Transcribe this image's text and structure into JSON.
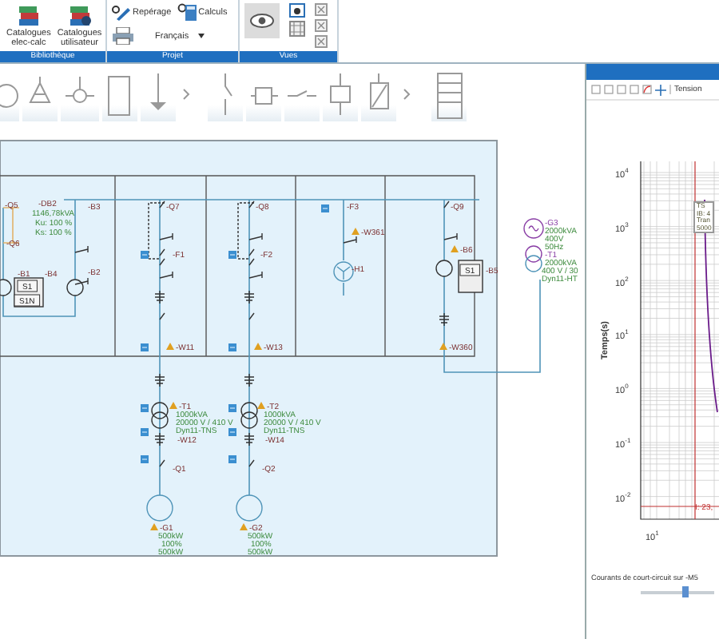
{
  "ribbon": {
    "groups": [
      {
        "label": "Bibliothèque",
        "items": [
          {
            "kind": "big",
            "label": "Catalogues elec-calc"
          },
          {
            "kind": "big",
            "label": "Catalogues utilisateur"
          }
        ]
      },
      {
        "label": "Projet",
        "items": [
          {
            "kind": "tool",
            "label": "Repérage"
          },
          {
            "kind": "tool",
            "label": "Calculs"
          },
          {
            "kind": "dropdown",
            "label": "Français"
          }
        ]
      },
      {
        "label": "Vues"
      }
    ]
  },
  "schematic": {
    "labels": [
      {
        "kind": "ref",
        "text": "-Q5"
      },
      {
        "kind": "ref",
        "text": "-DB2"
      },
      {
        "kind": "spec",
        "text": "1146,78kVA"
      },
      {
        "kind": "spec",
        "text": "Ku: 100 %"
      },
      {
        "kind": "spec",
        "text": "Ks: 100 %"
      },
      {
        "kind": "ref",
        "text": "-Q6"
      },
      {
        "kind": "ref",
        "text": "-B3"
      },
      {
        "kind": "ref",
        "text": "-B1"
      },
      {
        "kind": "box",
        "text": "S1"
      },
      {
        "kind": "box",
        "text": "S1N"
      },
      {
        "kind": "ref",
        "text": "-B4"
      },
      {
        "kind": "ref",
        "text": "-B2"
      },
      {
        "kind": "ref",
        "text": "-Q7"
      },
      {
        "kind": "ref",
        "text": "-F1"
      },
      {
        "kind": "warning",
        "text": "-W11"
      },
      {
        "kind": "ref",
        "text": "-Q8"
      },
      {
        "kind": "ref",
        "text": "-F2"
      },
      {
        "kind": "warning",
        "text": "-W13"
      },
      {
        "kind": "ref",
        "text": "-F3"
      },
      {
        "kind": "warning",
        "text": "-W361"
      },
      {
        "kind": "ref",
        "text": "-H1"
      },
      {
        "kind": "ref",
        "text": "-Q9"
      },
      {
        "kind": "warning",
        "text": "-B6"
      },
      {
        "kind": "box",
        "text": "S1"
      },
      {
        "kind": "ref",
        "text": "-B5"
      },
      {
        "kind": "warning",
        "text": "-W360"
      },
      {
        "kind": "source",
        "text": "-G3"
      },
      {
        "kind": "spec",
        "text": "2000kVA"
      },
      {
        "kind": "spec",
        "text": "400V"
      },
      {
        "kind": "spec",
        "text": "50Hz"
      },
      {
        "kind": "source",
        "text": "-T1"
      },
      {
        "kind": "spec",
        "text": "2000kVA"
      },
      {
        "kind": "spec",
        "text": "400 V / 30"
      },
      {
        "kind": "spec",
        "text": "Dyn11-HT"
      },
      {
        "kind": "warning",
        "text": "-T1"
      },
      {
        "kind": "spec",
        "text": "1000kVA"
      },
      {
        "kind": "spec",
        "text": "20000 V / 410 V"
      },
      {
        "kind": "spec",
        "text": "Dyn11-TNS"
      },
      {
        "kind": "ref",
        "text": "-W12"
      },
      {
        "kind": "ref",
        "text": "-Q1"
      },
      {
        "kind": "warning",
        "text": "-G1"
      },
      {
        "kind": "spec",
        "text": "500kW"
      },
      {
        "kind": "spec",
        "text": "100%"
      },
      {
        "kind": "spec",
        "text": "500kW"
      },
      {
        "kind": "warning",
        "text": "-T2"
      },
      {
        "kind": "spec",
        "text": "1000kVA"
      },
      {
        "kind": "spec",
        "text": "20000 V / 410 V"
      },
      {
        "kind": "spec",
        "text": "Dyn11-TNS"
      },
      {
        "kind": "ref",
        "text": "-W14"
      },
      {
        "kind": "ref",
        "text": "-Q2"
      },
      {
        "kind": "warning",
        "text": "-G2"
      },
      {
        "kind": "spec",
        "text": "500kW"
      },
      {
        "kind": "spec",
        "text": "100%"
      },
      {
        "kind": "spec",
        "text": "500kW"
      }
    ]
  },
  "curve_panel": {
    "toolbar_label": "Tension",
    "plot": {
      "y_axis_title": "Temps(s)",
      "y_tick_labels": [
        "10$^{4}$",
        "10$^{3}$",
        "10$^{2}$",
        "10$^{1}$",
        "10$^{0}$",
        "10$^{-1}$",
        "10$^{-2}$"
      ],
      "x_tick_labels": [
        "10$^{1}$"
      ],
      "marker_label": "I: 23,",
      "curve_note": [
        "TS",
        "IB: 4",
        "Tran",
        "5000"
      ]
    },
    "slider": {
      "label": "Courants de court-circuit sur -M5",
      "level": 0.6
    }
  }
}
